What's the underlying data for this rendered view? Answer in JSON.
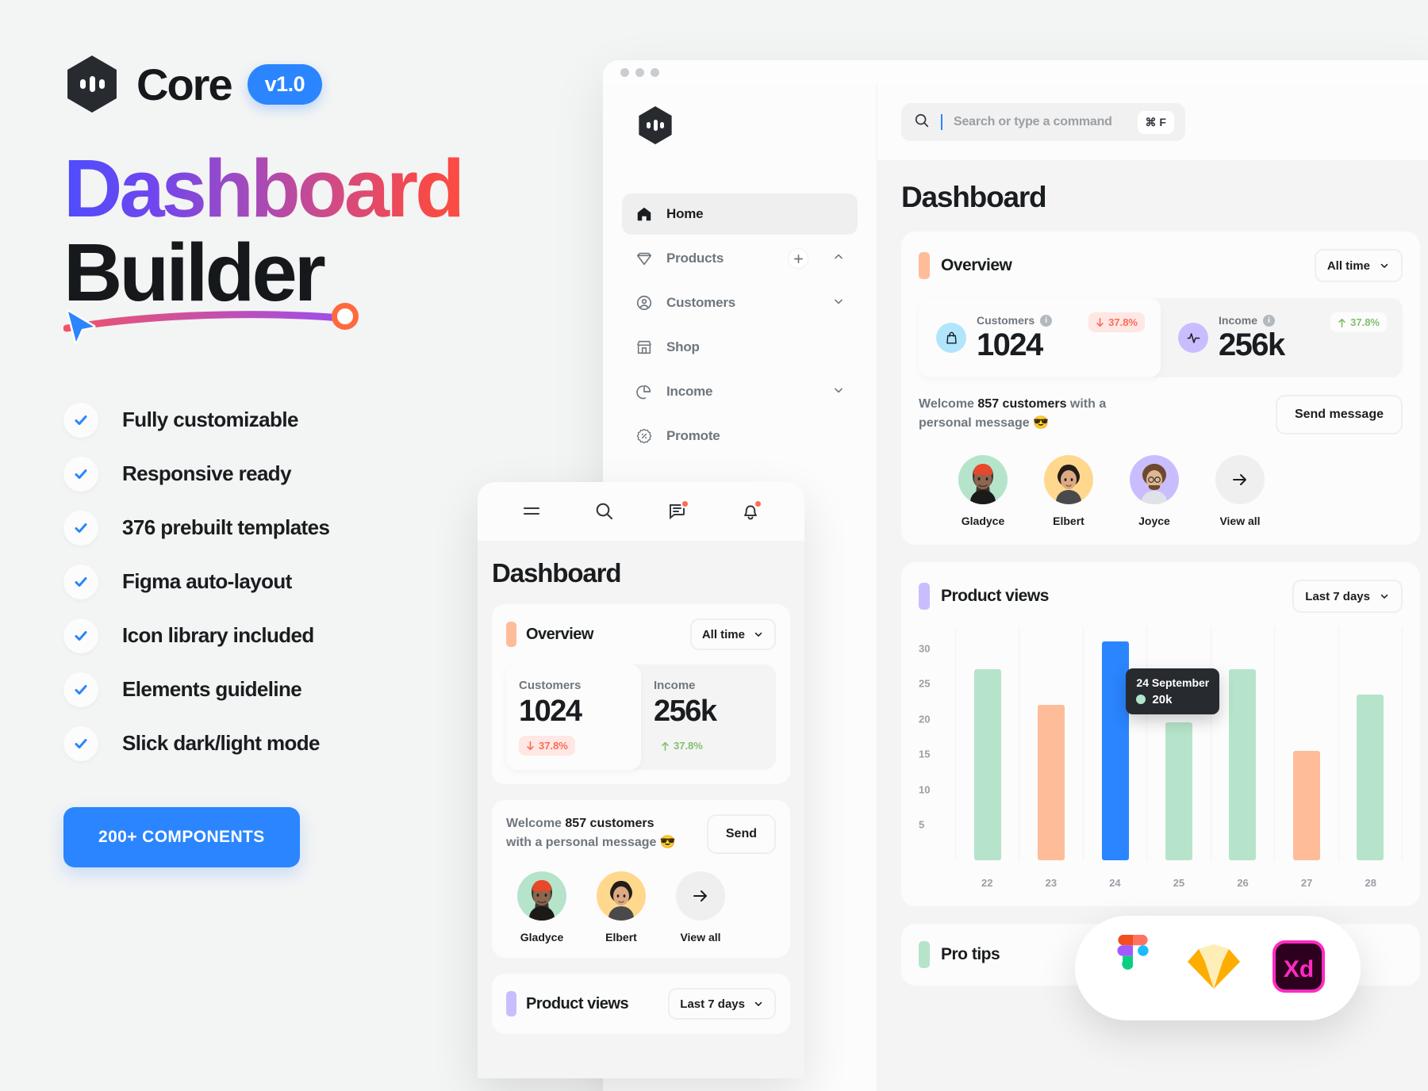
{
  "promo": {
    "logo_name": "Core",
    "version_badge": "v1.0",
    "headline_line1": "Dashboard",
    "headline_line2": "Builder",
    "features": [
      "Fully customizable",
      "Responsive ready",
      "376 prebuilt templates",
      "Figma auto-layout",
      "Icon library included",
      "Elements guideline",
      "Slick dark/light mode"
    ],
    "cta_label": "200+ COMPONENTS"
  },
  "desktop": {
    "sidebar": {
      "items": [
        {
          "label": "Home",
          "icon": "home-icon",
          "active": true,
          "plus": false,
          "chevron": ""
        },
        {
          "label": "Products",
          "icon": "diamond-icon",
          "active": false,
          "plus": true,
          "chevron": "up"
        },
        {
          "label": "Customers",
          "icon": "user-circle-icon",
          "active": false,
          "plus": false,
          "chevron": "down"
        },
        {
          "label": "Shop",
          "icon": "store-icon",
          "active": false,
          "plus": false,
          "chevron": ""
        },
        {
          "label": "Income",
          "icon": "pie-chart-icon",
          "active": false,
          "plus": false,
          "chevron": "down"
        },
        {
          "label": "Promote",
          "icon": "percent-badge-icon",
          "active": false,
          "plus": false,
          "chevron": ""
        }
      ]
    },
    "search": {
      "placeholder": "Search or type a command",
      "shortcut": "⌘ F",
      "icon": "search-icon"
    },
    "page_title": "Dashboard",
    "overview": {
      "title": "Overview",
      "accent": "#ffbc99",
      "range_label": "All time",
      "stats": [
        {
          "label": "Customers",
          "value": "1024",
          "delta": "37.8%",
          "direction": "down",
          "icon": "bag-icon",
          "icon_bg": "#b1e5fc"
        },
        {
          "label": "Income",
          "value": "256k",
          "delta": "37.8%",
          "direction": "up",
          "icon": "pulse-icon",
          "icon_bg": "#cabdff"
        }
      ],
      "welcome_pre": "Welcome ",
      "welcome_bold": "857 customers",
      "welcome_post": " with a personal message 😎",
      "send_label": "Send message",
      "people": [
        {
          "name": "Gladyce",
          "bg": "#b5e4ca"
        },
        {
          "name": "Elbert",
          "bg": "#ffd88d"
        },
        {
          "name": "Joyce",
          "bg": "#cabdff"
        },
        {
          "name": "View all",
          "bg": "#efefef"
        }
      ]
    },
    "product_views": {
      "title": "Product views",
      "accent": "#cabdff",
      "range_label": "Last 7 days",
      "tooltip_date": "24 September",
      "tooltip_value": "20k"
    },
    "pro_tips": {
      "title": "Pro tips",
      "accent": "#b5e4ca"
    }
  },
  "mobile": {
    "icons": [
      "menu-icon",
      "search-icon",
      "messages-icon",
      "bell-icon"
    ],
    "title": "Dashboard",
    "overview": {
      "title": "Overview",
      "accent": "#ffbc99",
      "range_label": "All time",
      "stats": [
        {
          "label": "Customers",
          "value": "1024",
          "delta": "37.8%",
          "direction": "down"
        },
        {
          "label": "Income",
          "value": "256k",
          "delta": "37.8%",
          "direction": "up"
        }
      ],
      "welcome_pre": "Welcome ",
      "welcome_bold": "857 customers",
      "welcome_post": " with a personal message 😎",
      "send_label": "Send",
      "people": [
        {
          "name": "Gladyce",
          "bg": "#b5e4ca"
        },
        {
          "name": "Elbert",
          "bg": "#ffd88d"
        },
        {
          "name": "View all",
          "bg": "#efefef"
        }
      ]
    },
    "product_views": {
      "title": "Product views",
      "accent": "#cabdff",
      "range_label": "Last 7 days"
    }
  },
  "tools": [
    "figma-logo",
    "sketch-logo",
    "adobe-xd-logo"
  ],
  "colors": {
    "brand_blue": "#2a85ff",
    "green": "#b5e4ca",
    "orange": "#ffbc99",
    "purple": "#cabdff",
    "red": "#ff6a55",
    "green_text": "#83bf6e"
  },
  "chart_data": {
    "type": "bar",
    "title": "Product views",
    "categories": [
      "22",
      "23",
      "24",
      "25",
      "26",
      "27",
      "28"
    ],
    "values": [
      27,
      22,
      31,
      19.5,
      27,
      15.5,
      23.5
    ],
    "bar_colors": [
      "#b5e4ca",
      "#ffbc99",
      "#2a85ff",
      "#b5e4ca",
      "#b5e4ca",
      "#ffbc99",
      "#b5e4ca"
    ],
    "highlighted_index": 2,
    "yticks": [
      5,
      10,
      15,
      20,
      25,
      30
    ],
    "ylim": [
      0,
      33
    ],
    "xlabel": "",
    "ylabel": "",
    "grid": true,
    "legend": false,
    "annotations": [
      {
        "index": 2,
        "date": "24 September",
        "value": "20k"
      }
    ]
  }
}
